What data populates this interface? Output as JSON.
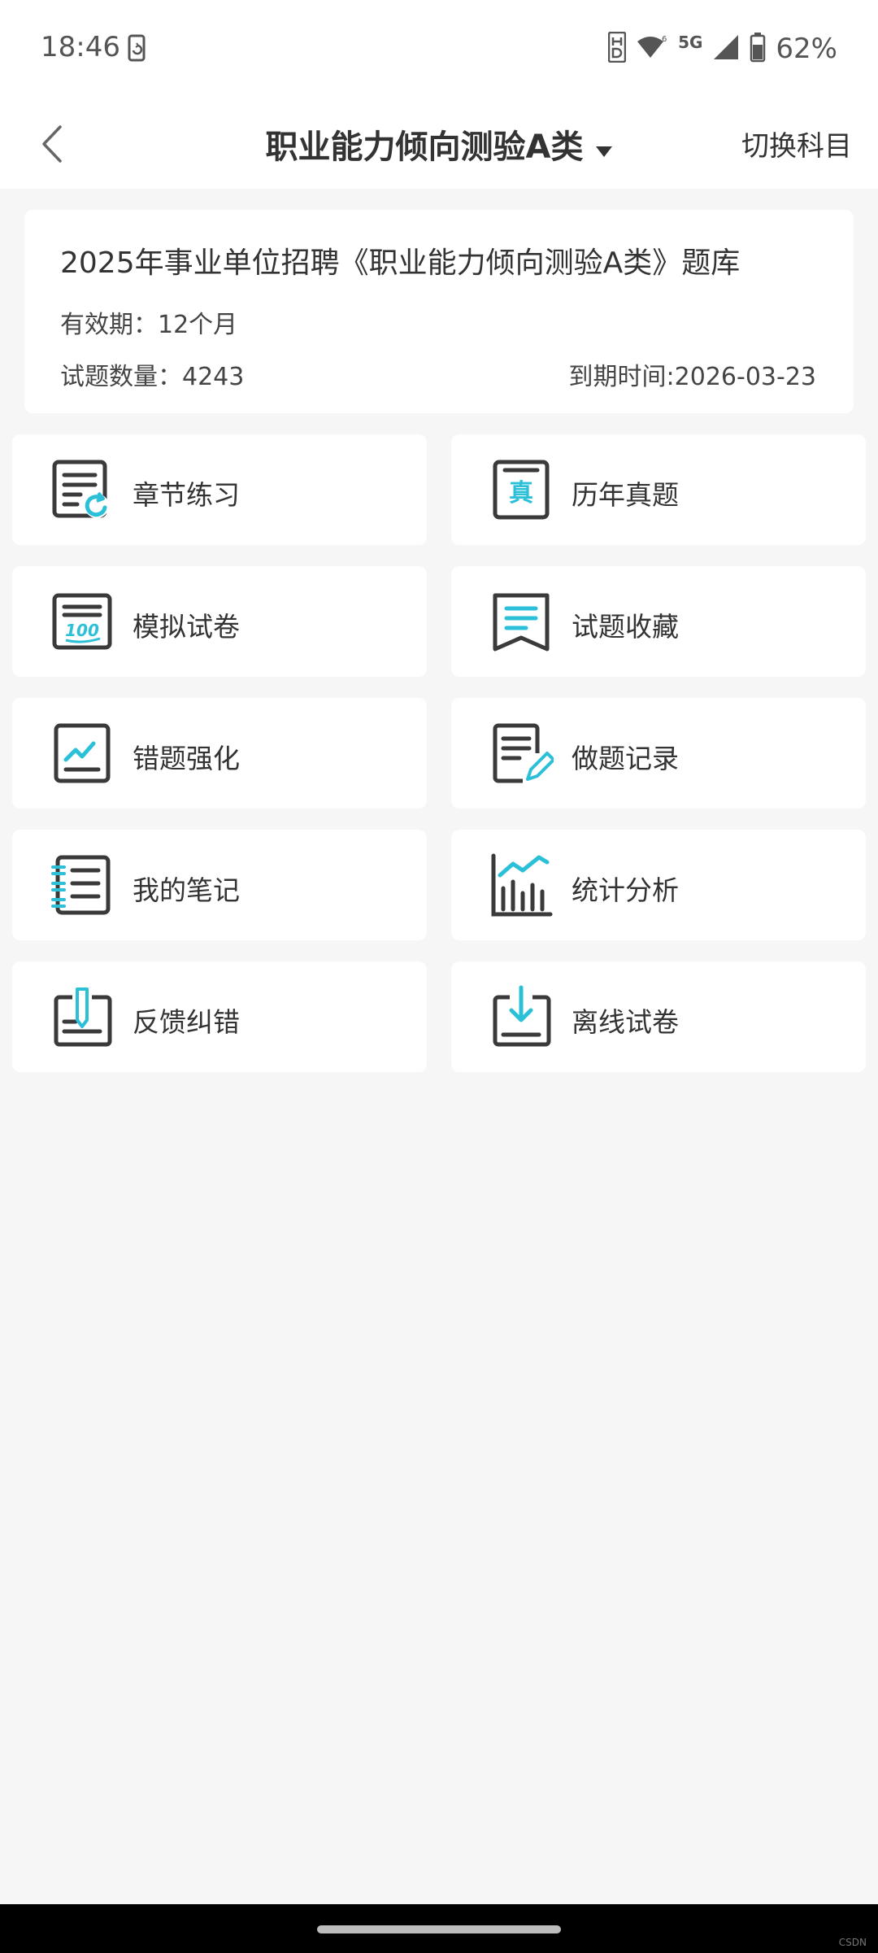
{
  "status_bar": {
    "time": "18:46",
    "network": "5G",
    "battery": "62%",
    "icons": [
      "phone-rotate-icon",
      "hd-icon",
      "wifi-6-icon",
      "signal-icon",
      "battery-icon"
    ]
  },
  "header": {
    "title": "职业能力倾向测验A类",
    "switch_label": "切换科目"
  },
  "info": {
    "bank_title": "2025年事业单位招聘《职业能力倾向测验A类》题库",
    "validity": "有效期：12个月",
    "question_count": "试题数量：4243",
    "expiry": "到期时间:2026-03-23"
  },
  "menu": [
    {
      "label": "章节练习",
      "icon": "chapter-practice-icon"
    },
    {
      "label": "历年真题",
      "icon": "past-exams-icon"
    },
    {
      "label": "模拟试卷",
      "icon": "mock-exam-icon"
    },
    {
      "label": "试题收藏",
      "icon": "bookmark-icon"
    },
    {
      "label": "错题强化",
      "icon": "wrong-questions-icon"
    },
    {
      "label": "做题记录",
      "icon": "practice-record-icon"
    },
    {
      "label": "我的笔记",
      "icon": "notes-icon"
    },
    {
      "label": "统计分析",
      "icon": "statistics-icon"
    },
    {
      "label": "反馈纠错",
      "icon": "feedback-icon"
    },
    {
      "label": "离线试卷",
      "icon": "offline-download-icon"
    }
  ],
  "colors": {
    "accent": "#2bc0d8",
    "icon_dark": "#3a3a3a",
    "background": "#f6f6f6",
    "card": "#ffffff"
  },
  "nav": {
    "badge": "CSDN"
  }
}
